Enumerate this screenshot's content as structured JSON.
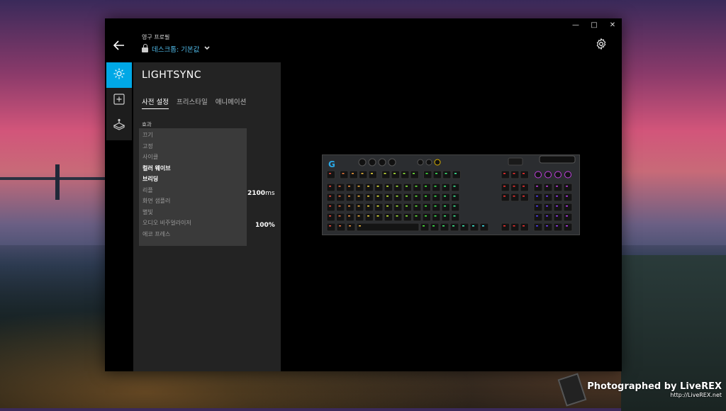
{
  "window": {
    "minimize": "—",
    "maximize": "□",
    "close": "✕"
  },
  "header": {
    "back_icon": "back-arrow-icon",
    "profile_caption": "영구 프로필",
    "profile_name": "데스크톱: 기본값",
    "settings_icon": "gear-icon"
  },
  "iconbar": {
    "items": [
      {
        "icon": "lightsync-sun-icon",
        "active": true
      },
      {
        "icon": "add-square-icon",
        "active": false
      },
      {
        "icon": "gshift-joystick-icon",
        "active": false
      }
    ],
    "accent": "#00a8e6"
  },
  "panel": {
    "title": "LIGHTSYNC",
    "tabs": [
      "사전 설정",
      "프리스타일",
      "애니메이션"
    ],
    "active_tab": "사전 설정",
    "effect_label": "효과",
    "effect_options": [
      {
        "label": "끄기",
        "highlight": false
      },
      {
        "label": "고정",
        "highlight": false
      },
      {
        "label": "사이클",
        "highlight": false
      },
      {
        "label": "컬러 웨이브",
        "highlight": true
      },
      {
        "label": "브리딩",
        "highlight": true
      },
      {
        "label": "리플",
        "highlight": false
      },
      {
        "label": "화면 샘플러",
        "highlight": false
      },
      {
        "label": "별빛",
        "highlight": false
      },
      {
        "label": "오디오 비주얼라이저",
        "highlight": false
      },
      {
        "label": "에코 프레스",
        "highlight": false
      }
    ],
    "speed_value": "2100",
    "speed_unit": "ms",
    "brightness_value": "100%"
  },
  "device": {
    "logo_icon": "logitech-g-logo-icon",
    "accent_key_color": "#c040e0"
  },
  "watermark": {
    "line1": "Photographed by LiveREX",
    "line2": "http://LiveREX.net"
  }
}
